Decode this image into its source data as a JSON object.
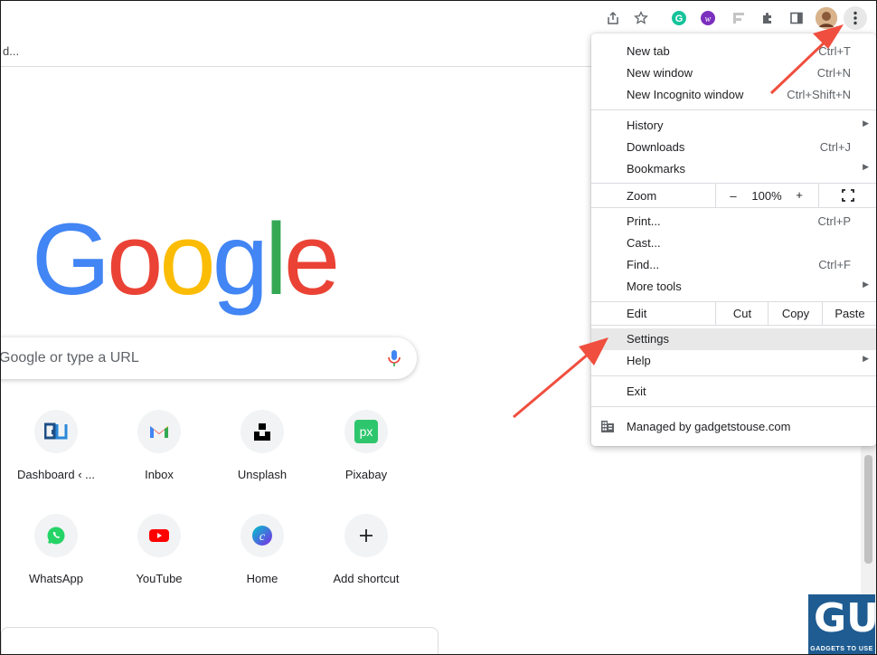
{
  "toolbar": {
    "icons": [
      "share-icon",
      "star-icon",
      "grammarly-icon",
      "w-extension-icon",
      "extension-f-icon",
      "puzzle-icon",
      "sidebar-icon",
      "avatar",
      "kebab-menu-icon"
    ]
  },
  "bookmarks": {
    "text": "d..."
  },
  "logo": {
    "letters": [
      "G",
      "o",
      "o",
      "g",
      "l",
      "e"
    ],
    "colors": [
      "#4285F4",
      "#EA4335",
      "#FBBC05",
      "#4285F4",
      "#34A853",
      "#EA4335"
    ]
  },
  "search": {
    "placeholder": "Google or type a URL"
  },
  "shortcuts": [
    {
      "label": "Dashboard ‹ ...",
      "icon": "gadgetstouse-icon"
    },
    {
      "label": "Inbox",
      "icon": "gmail-icon"
    },
    {
      "label": "Unsplash",
      "icon": "unsplash-icon"
    },
    {
      "label": "Pixabay",
      "icon": "pixabay-icon"
    },
    {
      "label": "WhatsApp",
      "icon": "whatsapp-icon"
    },
    {
      "label": "YouTube",
      "icon": "youtube-icon"
    },
    {
      "label": "Home",
      "icon": "canva-icon"
    },
    {
      "label": "Add shortcut",
      "icon": "plus-icon"
    }
  ],
  "menu": {
    "new_tab": {
      "label": "New tab",
      "shortcut": "Ctrl+T"
    },
    "new_window": {
      "label": "New window",
      "shortcut": "Ctrl+N"
    },
    "new_incognito": {
      "label": "New Incognito window",
      "shortcut": "Ctrl+Shift+N"
    },
    "history": {
      "label": "History"
    },
    "downloads": {
      "label": "Downloads",
      "shortcut": "Ctrl+J"
    },
    "bookmarks": {
      "label": "Bookmarks"
    },
    "zoom": {
      "label": "Zoom",
      "minus": "–",
      "value": "100%",
      "plus": "+"
    },
    "print": {
      "label": "Print...",
      "shortcut": "Ctrl+P"
    },
    "cast": {
      "label": "Cast..."
    },
    "find": {
      "label": "Find...",
      "shortcut": "Ctrl+F"
    },
    "more_tools": {
      "label": "More tools"
    },
    "edit": {
      "label": "Edit",
      "cut": "Cut",
      "copy": "Copy",
      "paste": "Paste"
    },
    "settings": {
      "label": "Settings"
    },
    "help": {
      "label": "Help"
    },
    "exit": {
      "label": "Exit"
    },
    "managed": {
      "label": "Managed by gadgetstouse.com"
    }
  },
  "watermark": {
    "logo": "GU",
    "text": "GADGETS TO USE"
  },
  "colors": {
    "annotation_arrow": "#f04e3e"
  }
}
